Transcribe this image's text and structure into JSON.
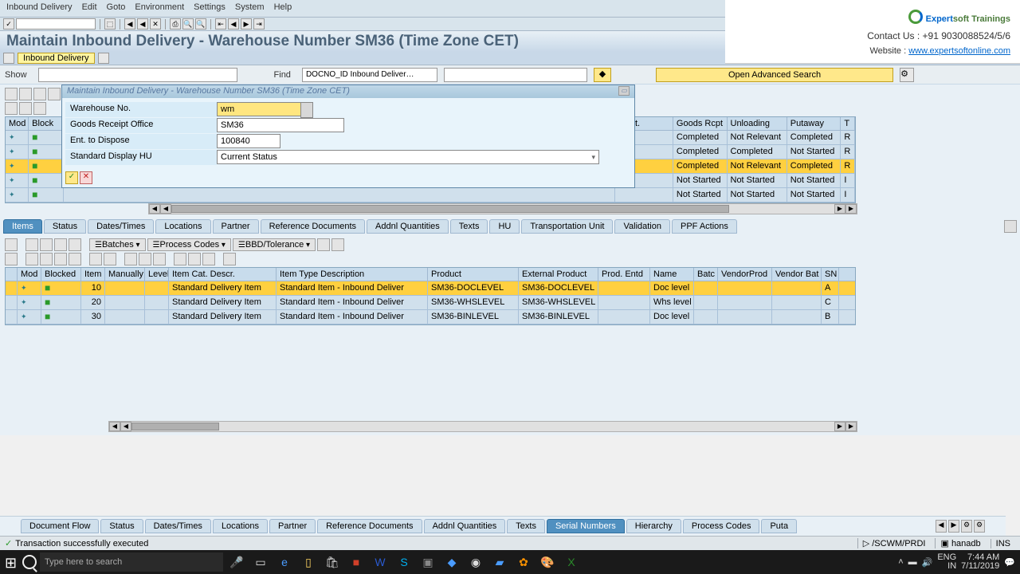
{
  "menubar": {
    "items": [
      "Inbound Delivery",
      "Edit",
      "Goto",
      "Environment",
      "Settings",
      "System",
      "Help"
    ]
  },
  "page_title": "Maintain Inbound Delivery - Warehouse Number SM36 (Time Zone CET)",
  "sub_chip": "Inbound Delivery",
  "search": {
    "show_label": "Show",
    "find_label": "Find",
    "find_value": "DOCNO_ID Inbound Deliver…",
    "adv_label": "Open Advanced Search"
  },
  "popup": {
    "title": "Maintain Inbound Delivery - Warehouse Number SM36 (Time Zone CET)",
    "rows": {
      "warehouse_lbl": "Warehouse No.",
      "warehouse_val": "wm",
      "gro_lbl": "Goods Receipt Office",
      "gro_val": "SM36",
      "etd_lbl": "Ent. to Dispose",
      "etd_val": "100840",
      "sdhu_lbl": "Standard Display HU",
      "sdhu_val": "Current Status"
    }
  },
  "upper_cols": {
    "mod": "Mod",
    "blocked": "Block",
    "sched": "ed.pt.",
    "gr": "Goods Rcpt",
    "unl": "Unloading",
    "put": "Putaway",
    "t": "T"
  },
  "upper_rows": [
    {
      "gr": "Completed",
      "unl": "Not Relevant",
      "put": "Completed",
      "t": "R"
    },
    {
      "gr": "Completed",
      "unl": "Completed",
      "put": "Not Started",
      "t": "R"
    },
    {
      "gr": "Completed",
      "unl": "Not Relevant",
      "put": "Completed",
      "t": "R",
      "sel": true
    },
    {
      "gr": "Not Started",
      "unl": "Not Started",
      "put": "Not Started",
      "t": "I"
    },
    {
      "gr": "Not Started",
      "unl": "Not Started",
      "put": "Not Started",
      "t": "I"
    }
  ],
  "mid_tabs": [
    "Items",
    "Status",
    "Dates/Times",
    "Locations",
    "Partner",
    "Reference Documents",
    "Addnl Quantities",
    "Texts",
    "HU",
    "Transportation Unit",
    "Validation",
    "PPF Actions"
  ],
  "mid_active": "Items",
  "lt_buttons": {
    "batches": "Batches",
    "process": "Process Codes",
    "bbd": "BBD/Tolerance"
  },
  "lower_cols": {
    "mod": "Mod",
    "blk": "Blocked",
    "item": "Item",
    "man": "Manually",
    "lvl": "Level",
    "itc": "Item Cat. Descr.",
    "itt": "Item Type Description",
    "prd": "Product",
    "ext": "External Product",
    "pe": "Prod. Entd",
    "nm": "Name",
    "bt": "Batc",
    "vp": "VendorProd",
    "vb": "Vendor Bat",
    "sn": "SN"
  },
  "lower_rows": [
    {
      "item": "10",
      "itc": "Standard Delivery Item",
      "itt": "Standard Item - Inbound Deliver",
      "prd": "SM36-DOCLEVEL",
      "ext": "SM36-DOCLEVEL",
      "nm": "Doc level",
      "sn": "A",
      "sel": true
    },
    {
      "item": "20",
      "itc": "Standard Delivery Item",
      "itt": "Standard Item - Inbound Deliver",
      "prd": "SM36-WHSLEVEL",
      "ext": "SM36-WHSLEVEL",
      "nm": "Whs level",
      "sn": "C"
    },
    {
      "item": "30",
      "itc": "Standard Delivery Item",
      "itt": "Standard Item - Inbound Deliver",
      "prd": "SM36-BINLEVEL",
      "ext": "SM36-BINLEVEL",
      "nm": "Doc level",
      "sn": "B"
    }
  ],
  "bottom_tabs": [
    "Document Flow",
    "Status",
    "Dates/Times",
    "Locations",
    "Partner",
    "Reference Documents",
    "Addnl Quantities",
    "Texts",
    "Serial Numbers",
    "Hierarchy",
    "Process Codes",
    "Puta"
  ],
  "bottom_active": "Serial Numbers",
  "status": {
    "msg": "Transaction successfully executed",
    "path": "/SCWM/PRDI",
    "sys": "hanadb",
    "ins": "INS"
  },
  "taskbar": {
    "search_placeholder": "Type here to search",
    "lang": "ENG",
    "loc": "IN",
    "time": "7:44 AM",
    "date": "7/11/2019"
  },
  "watermark": {
    "title1": "Expert",
    "title2": "soft Trainings",
    "line1": "Contact Us : +91 9030088524/5/6",
    "line2_lbl": "Website : ",
    "line2_link": "www.expertsoftonline.com"
  }
}
